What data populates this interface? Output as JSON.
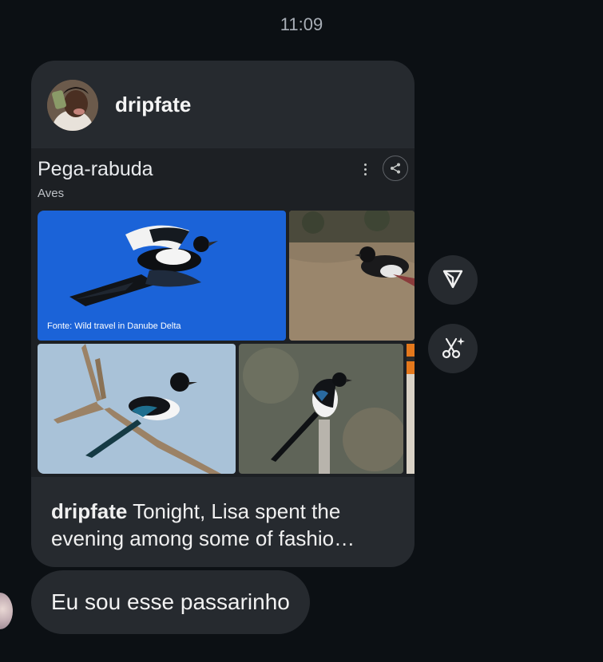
{
  "timestamp": "11:09",
  "post": {
    "username": "dripfate",
    "shared": {
      "title": "Pega-rabuda",
      "subtitle": "Aves",
      "photo_credit": "Fonte: Wild travel in Danube Delta",
      "images": [
        {
          "icon": "magpie-flying-blue-sky-image"
        },
        {
          "icon": "magpie-on-grass-image"
        },
        {
          "icon": "magpie-on-branch-image"
        },
        {
          "icon": "magpie-on-post-image"
        },
        {
          "icon": "partial-image"
        }
      ]
    },
    "caption": {
      "username": "dripfate",
      "text": " Tonight, Lisa spent the evening among some of fashio…"
    }
  },
  "actions": {
    "share_icon": "paper-plane-icon",
    "ai_icon": "scissors-sparkle-icon"
  },
  "message": {
    "text": "Eu sou esse passarinho"
  },
  "colors": {
    "background": "#0c1014",
    "bubble": "#262a2f",
    "timestamp": "#a8aeb6"
  }
}
